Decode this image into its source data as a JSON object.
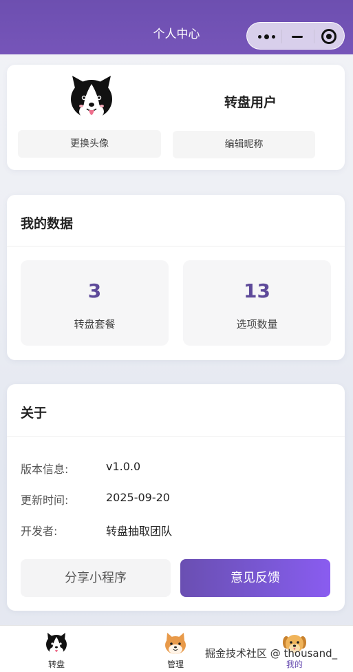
{
  "nav": {
    "title": "个人中心",
    "capsule": {
      "more_icon": "more-dots-icon",
      "minimize_icon": "minimize-icon",
      "close_icon": "target-circle-icon"
    }
  },
  "profile": {
    "avatar_icon": "dog-avatar",
    "nickname": "转盘用户",
    "change_avatar_label": "更换头像",
    "edit_nickname_label": "编辑昵称"
  },
  "my_data": {
    "title": "我的数据",
    "stats": [
      {
        "value": "3",
        "label": "转盘套餐"
      },
      {
        "value": "13",
        "label": "选项数量"
      }
    ]
  },
  "about": {
    "title": "关于",
    "rows": [
      {
        "key": "版本信息:",
        "value": "v1.0.0"
      },
      {
        "key": "更新时间:",
        "value": "2025-09-20"
      },
      {
        "key": "开发者:",
        "value": "转盘抽取团队"
      }
    ],
    "share_label": "分享小程序",
    "feedback_label": "意见反馈"
  },
  "tabbar": {
    "items": [
      {
        "label": "转盘",
        "icon": "husky-dog-icon",
        "active": false
      },
      {
        "label": "管理",
        "icon": "shiba-dog-icon",
        "active": false
      },
      {
        "label": "我的",
        "icon": "golden-dog-icon",
        "active": true
      }
    ]
  },
  "watermark": "掘金技术社区 @ thousand_",
  "colors": {
    "accent": "#6a4fb2",
    "nav_bg": "#7655b9"
  }
}
